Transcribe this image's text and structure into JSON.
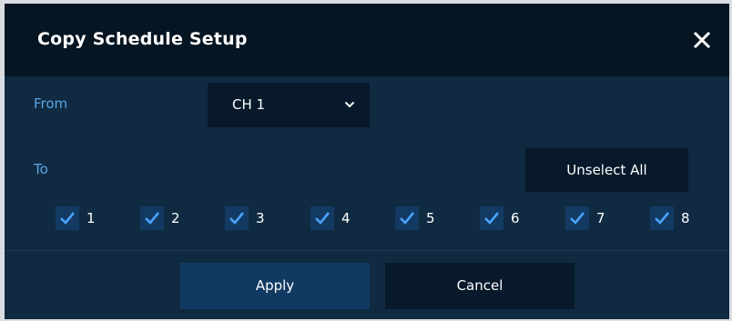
{
  "dialog": {
    "title": "Copy Schedule Setup",
    "close_icon": "close-icon"
  },
  "from": {
    "label": "From",
    "selected": "CH 1"
  },
  "to": {
    "label": "To",
    "unselect_label": "Unselect All",
    "channels": [
      {
        "label": "1",
        "checked": true
      },
      {
        "label": "2",
        "checked": true
      },
      {
        "label": "3",
        "checked": true
      },
      {
        "label": "4",
        "checked": true
      },
      {
        "label": "5",
        "checked": true
      },
      {
        "label": "6",
        "checked": true
      },
      {
        "label": "7",
        "checked": true
      },
      {
        "label": "8",
        "checked": true
      }
    ]
  },
  "buttons": {
    "apply": "Apply",
    "cancel": "Cancel"
  },
  "colors": {
    "accent_label": "#5aa5e4",
    "dialog_bg": "#0f2a41",
    "titlebar_bg": "#061522",
    "check": "#4aa3ff"
  }
}
